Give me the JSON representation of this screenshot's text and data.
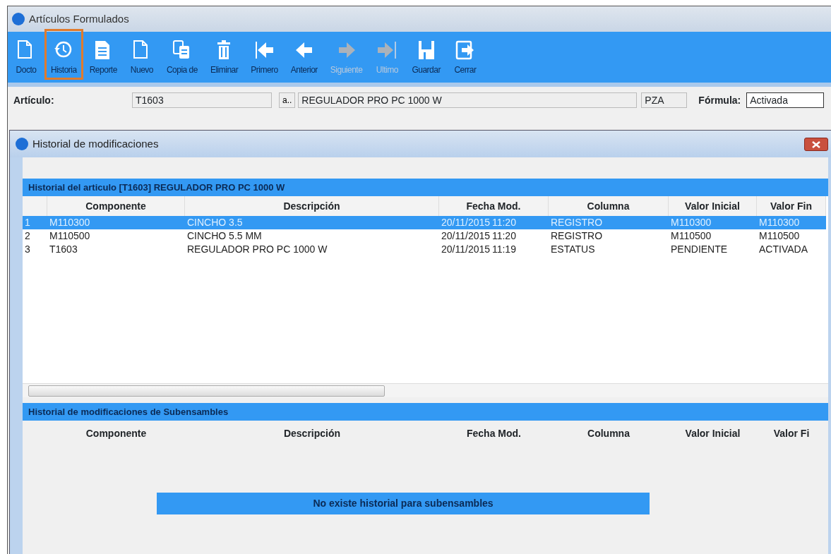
{
  "window": {
    "title": "Artículos Formulados"
  },
  "toolbar": [
    {
      "label": "Docto",
      "kind": "doc",
      "selected": false,
      "disabled": false
    },
    {
      "label": "Historia",
      "kind": "history",
      "selected": true,
      "disabled": false
    },
    {
      "label": "Reporte",
      "kind": "report",
      "selected": false,
      "disabled": false
    },
    {
      "label": "Nuevo",
      "kind": "doc",
      "selected": false,
      "disabled": false
    },
    {
      "label": "Copia de",
      "kind": "copy",
      "selected": false,
      "disabled": false
    },
    {
      "label": "Eliminar",
      "kind": "trash",
      "selected": false,
      "disabled": false
    },
    {
      "label": "Primero",
      "kind": "first",
      "selected": false,
      "disabled": false
    },
    {
      "label": "Anterior",
      "kind": "prev",
      "selected": false,
      "disabled": false
    },
    {
      "label": "Siguiente",
      "kind": "next",
      "selected": false,
      "disabled": true
    },
    {
      "label": "Ultimo",
      "kind": "last",
      "selected": false,
      "disabled": true
    },
    {
      "label": "Guardar",
      "kind": "save",
      "selected": false,
      "disabled": false
    },
    {
      "label": "Cerrar",
      "kind": "exit",
      "selected": false,
      "disabled": false
    }
  ],
  "form": {
    "article_label": "Artículo:",
    "article_code": "T1603",
    "lookup_button": "a..",
    "article_name": "REGULADOR PRO PC 1000 W",
    "unit": "PZA",
    "formula_label": "Fórmula:",
    "formula_value": "Activada"
  },
  "dialog": {
    "title": "Historial de modificaciones",
    "history": {
      "title": "Historial del articulo [T1603] REGULADOR PRO PC 1000 W",
      "columns": [
        "",
        "Componente",
        "Descripción",
        "Fecha Mod.",
        "Columna",
        "Valor Inicial",
        "Valor Fin"
      ],
      "rows": [
        {
          "cells": [
            "1",
            "M110300",
            "CINCHO 3.5",
            "20/11/2015  11:20",
            "REGISTRO",
            "M110300",
            "M110300"
          ],
          "selected": true
        },
        {
          "cells": [
            "2",
            "M110500",
            "CINCHO 5.5 MM",
            "20/11/2015  11:20",
            "REGISTRO",
            "M110500",
            "M110500"
          ],
          "selected": false
        },
        {
          "cells": [
            "3",
            "T1603",
            "REGULADOR PRO PC 1000 W",
            "20/11/2015  11:19",
            "ESTATUS",
            "PENDIENTE",
            "ACTIVADA"
          ],
          "selected": false
        }
      ]
    },
    "subassemblies": {
      "title": "Historial de modificaciones de Subensambles",
      "columns": [
        "",
        "Componente",
        "Descripción",
        "Fecha Mod.",
        "Columna",
        "Valor Inicial",
        "Valor Fi"
      ],
      "message": "No existe historial para subensambles"
    }
  }
}
